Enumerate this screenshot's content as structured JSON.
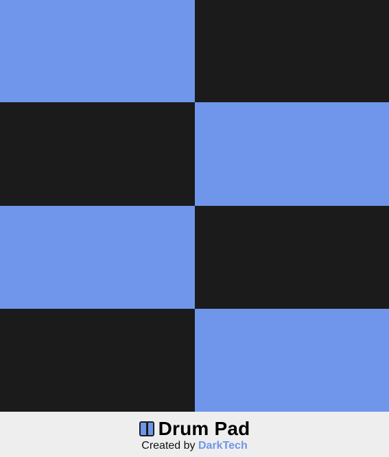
{
  "colors": {
    "pad_blue": "#6f96ea",
    "pad_black": "#1b1b1b",
    "footer_bg": "#eeeeee",
    "accent": "#6f96ea"
  },
  "pads": [
    {
      "id": "pad-1",
      "color": "pad_blue"
    },
    {
      "id": "pad-2",
      "color": "pad_black"
    },
    {
      "id": "pad-3",
      "color": "pad_black"
    },
    {
      "id": "pad-4",
      "color": "pad_blue"
    },
    {
      "id": "pad-5",
      "color": "pad_blue"
    },
    {
      "id": "pad-6",
      "color": "pad_black"
    },
    {
      "id": "pad-7",
      "color": "pad_black"
    },
    {
      "id": "pad-8",
      "color": "pad_blue"
    }
  ],
  "footer": {
    "icon": "drum-pad-icon",
    "title": "Drum Pad",
    "credit_prefix": "Created by ",
    "author": "DarkTech"
  }
}
